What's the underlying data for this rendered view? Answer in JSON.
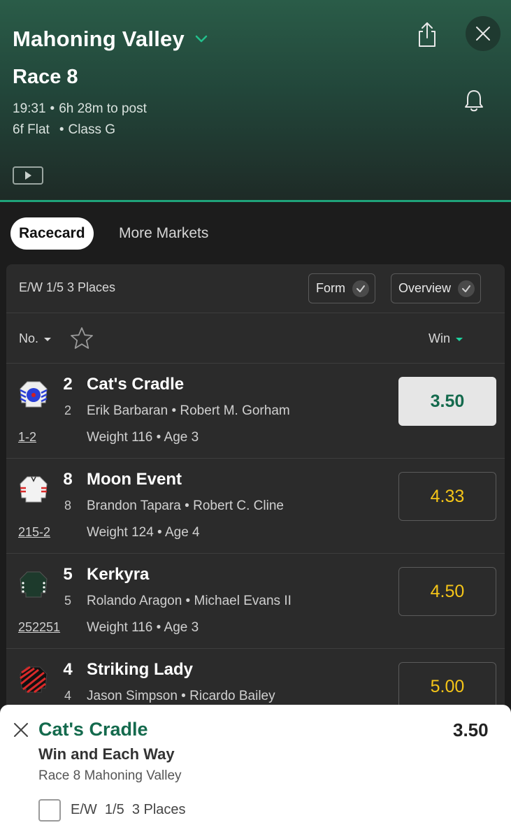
{
  "header": {
    "venue": "Mahoning Valley",
    "race": "Race 8",
    "time": "19:31",
    "countdown": "6h 28m to post",
    "distance": "6f Flat",
    "race_class": "Class G"
  },
  "tabs": [
    {
      "label": "Racecard",
      "active": true
    },
    {
      "label": "More Markets",
      "active": false
    }
  ],
  "racecard": {
    "ew_terms": "E/W 1/5 3 Places",
    "form_toggle": "Form",
    "overview_toggle": "Overview",
    "sort_label": "No.",
    "win_label": "Win"
  },
  "runners": [
    {
      "number": "2",
      "name": "Cat's Cradle",
      "draw": "2",
      "jockey": "Erik Barbaran",
      "trainer": "Robert M. Gorham",
      "form": "1-2",
      "weight": "Weight 116",
      "age": "Age 3",
      "odds": "3.50",
      "selected": true
    },
    {
      "number": "8",
      "name": "Moon Event",
      "draw": "8",
      "jockey": "Brandon Tapara",
      "trainer": "Robert C. Cline",
      "form": "215-2",
      "weight": "Weight 124",
      "age": "Age 4",
      "odds": "4.33",
      "selected": false
    },
    {
      "number": "5",
      "name": "Kerkyra",
      "draw": "5",
      "jockey": "Rolando Aragon",
      "trainer": "Michael Evans II",
      "form": "252251",
      "weight": "Weight 116",
      "age": "Age 3",
      "odds": "4.50",
      "selected": false
    },
    {
      "number": "4",
      "name": "Striking Lady",
      "draw": "4",
      "jockey": "Jason Simpson",
      "trainer": "Ricardo Bailey",
      "form": "",
      "weight": "",
      "age": "",
      "odds": "5.00",
      "selected": false
    }
  ],
  "betslip": {
    "selection": "Cat's Cradle",
    "odds": "3.50",
    "market": "Win and Each Way",
    "event": "Race 8 Mahoning Valley",
    "ew_label": "E/W",
    "ew_fraction": "1/5",
    "ew_places": "3 Places"
  },
  "colors": {
    "accent_green": "#146a4d",
    "odds_yellow": "#f5c518",
    "header_line": "#1fa37a"
  }
}
